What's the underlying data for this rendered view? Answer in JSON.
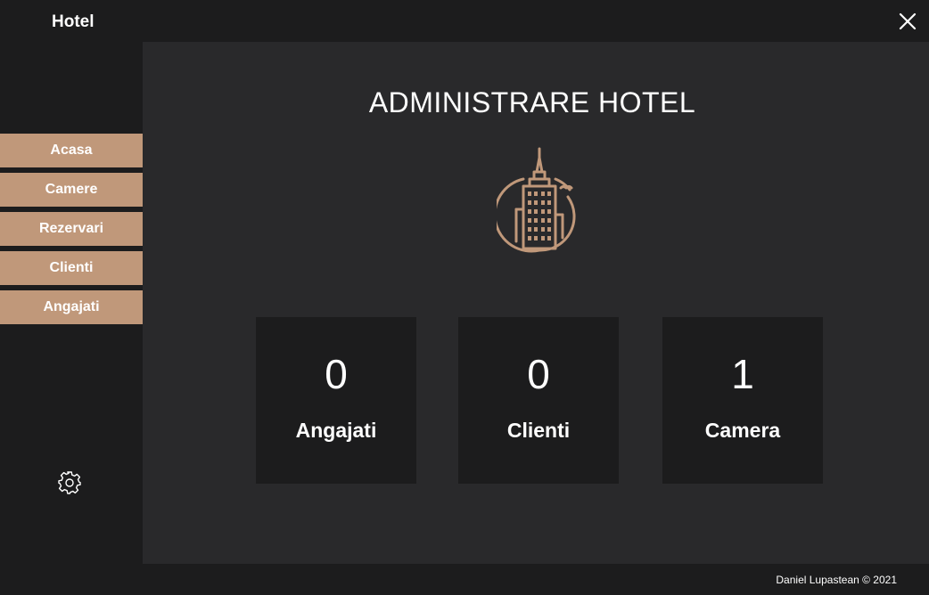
{
  "window": {
    "title": "Hotel",
    "close_icon": "close-icon"
  },
  "sidebar": {
    "items": [
      {
        "label": "Acasa"
      },
      {
        "label": "Camere"
      },
      {
        "label": "Rezervari"
      },
      {
        "label": "Clienti"
      },
      {
        "label": "Angajati"
      }
    ],
    "settings_icon": "gear-icon"
  },
  "main": {
    "title": "ADMINISTRARE HOTEL",
    "logo_icon": "building-icon",
    "stats": [
      {
        "value": "0",
        "label": "Angajati"
      },
      {
        "value": "0",
        "label": "Clienti"
      },
      {
        "value": "1",
        "label": "Camera"
      }
    ]
  },
  "footer": {
    "text": "Daniel Lupastean © 2021"
  },
  "colors": {
    "accent": "#c0987a",
    "background": "#1c1c1d",
    "panel": "#29292b",
    "text": "#ffffff"
  }
}
